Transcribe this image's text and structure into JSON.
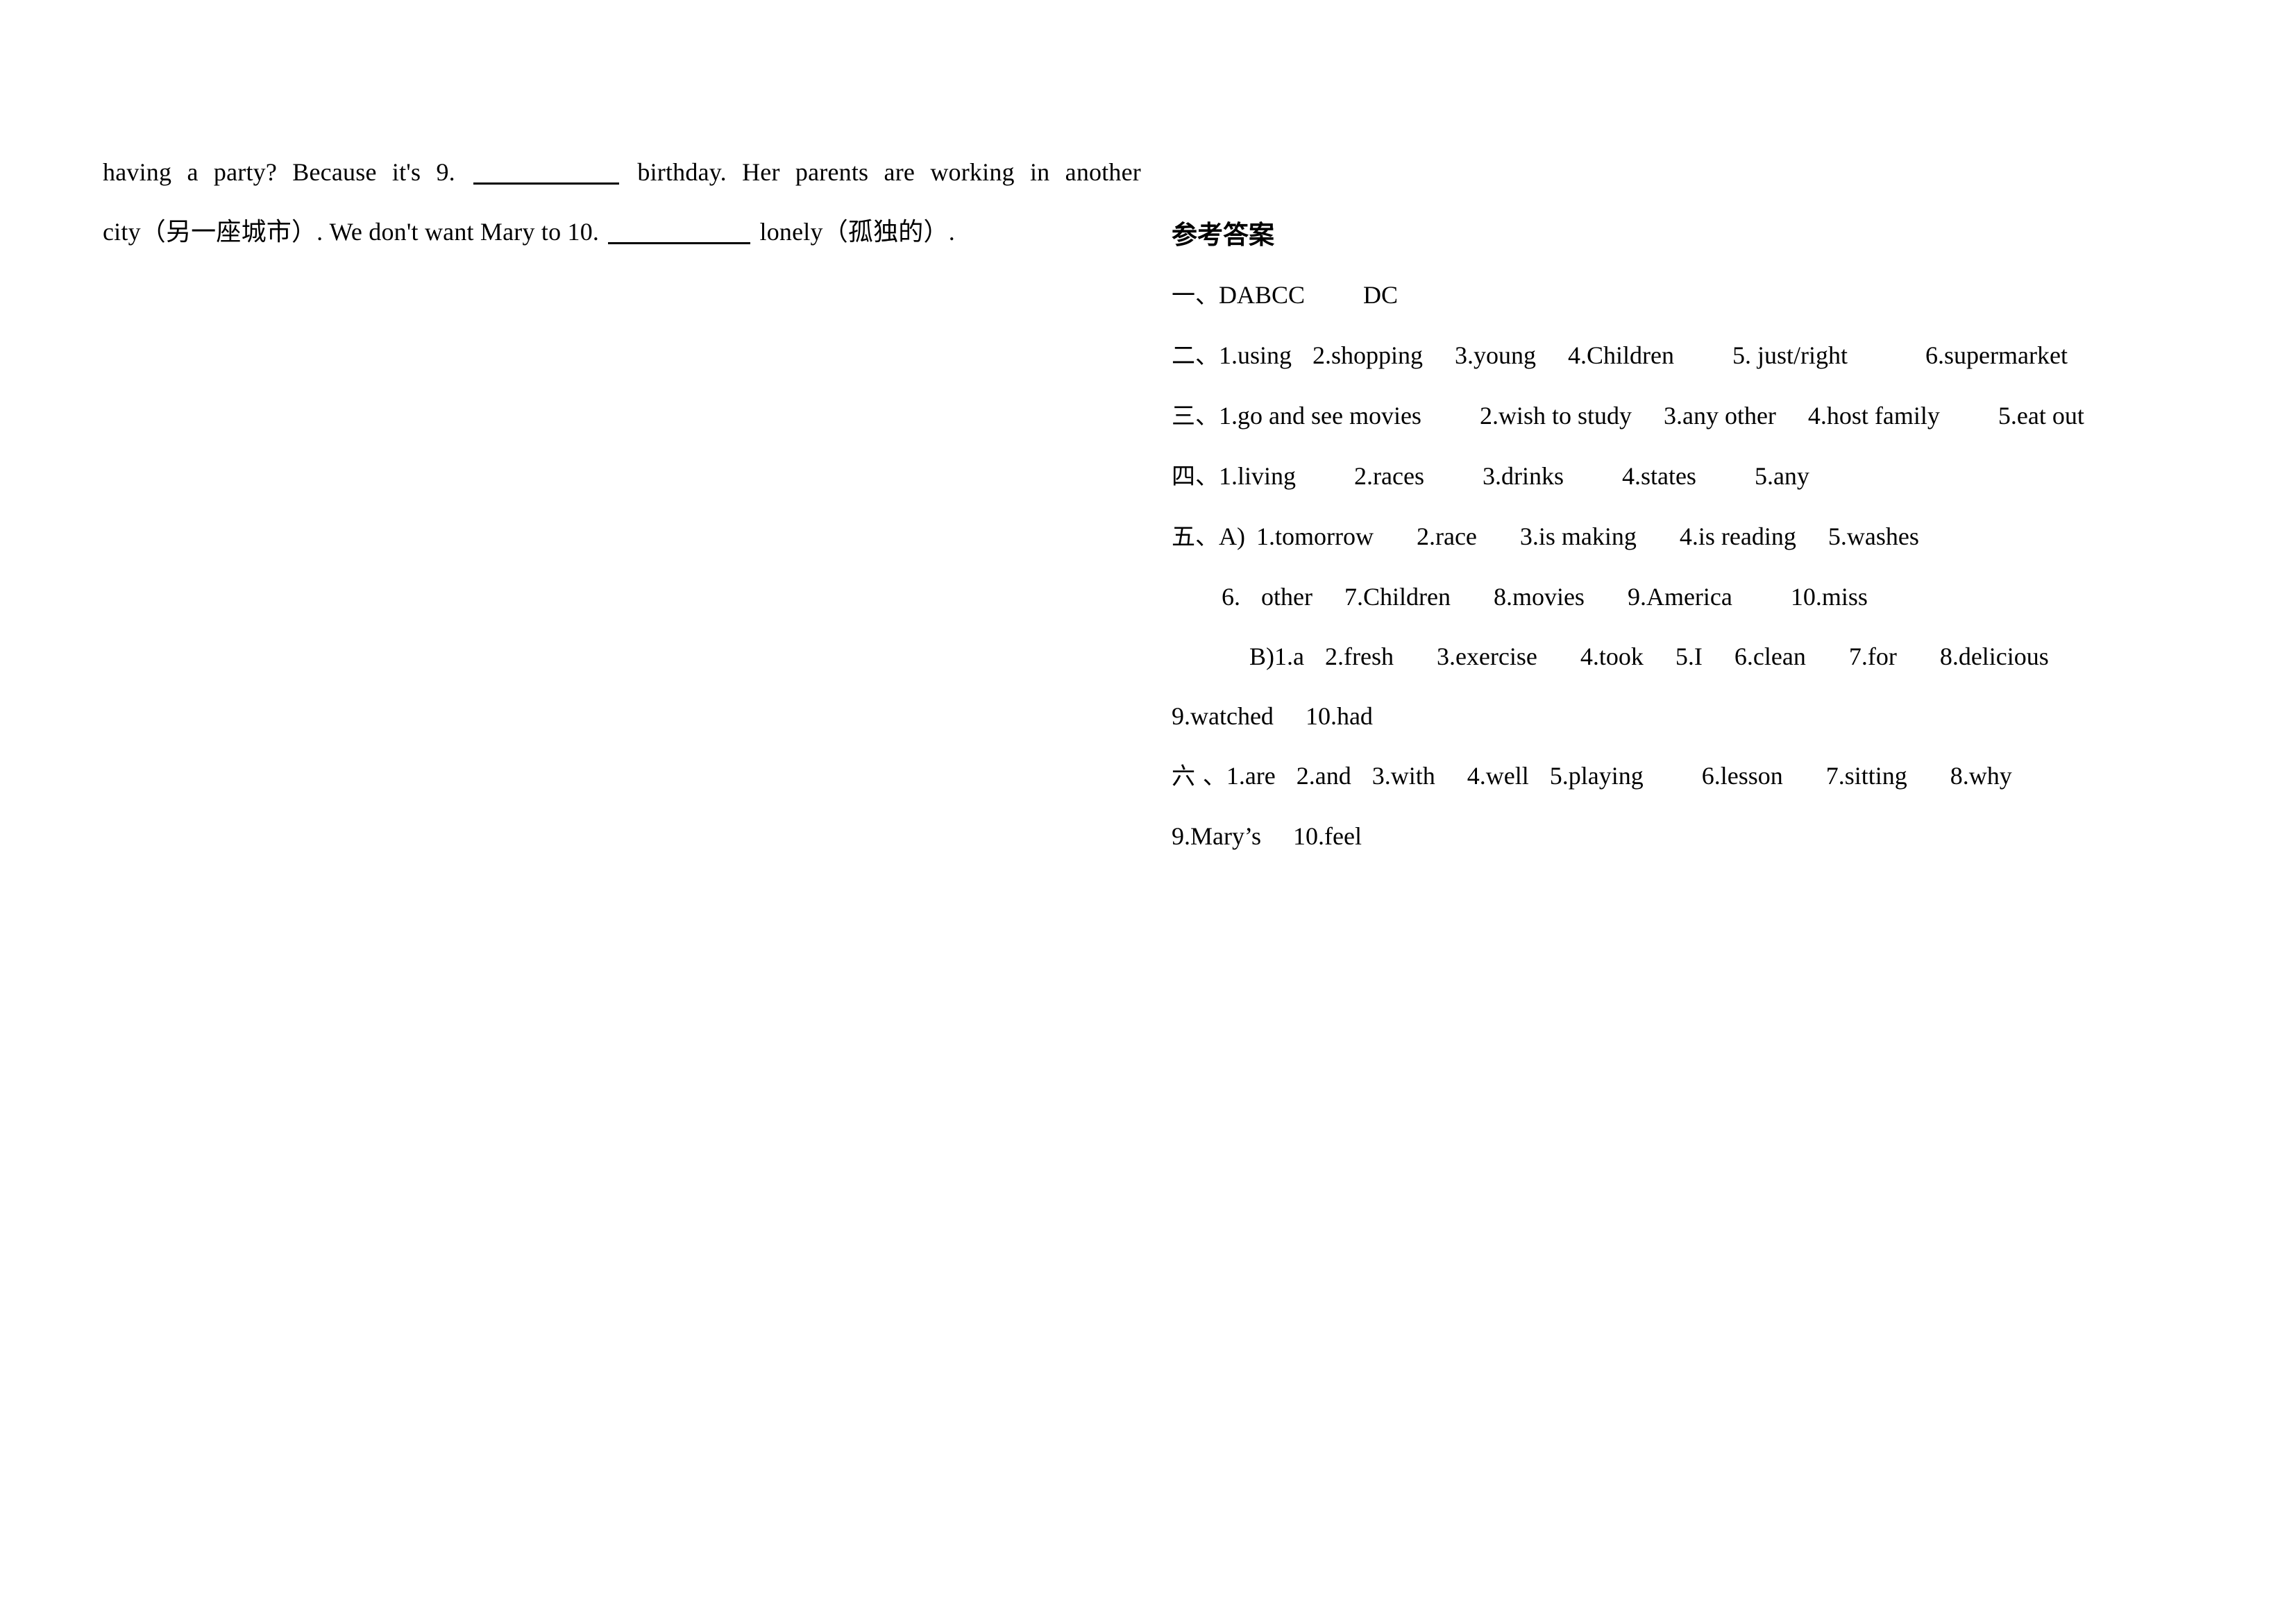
{
  "document": {
    "type": "english-exam-worksheet-with-answer-key",
    "page_background": "#ffffff",
    "text_color": "#000000"
  },
  "passage": {
    "line1": {
      "before_blank": "having a party? Because it's 9.",
      "after_blank": "birthday. Her parents are working in another"
    },
    "line2": {
      "before_blank": "city（另一座城市）. We don't want Mary to 10.",
      "after_blank": "lonely（孤独的）."
    }
  },
  "answer_key": {
    "title": "参考答案",
    "lines": [
      {
        "marker": "一、",
        "body": "DABCC",
        "body2": "DC",
        "indent": "none"
      },
      {
        "marker": "二、",
        "items": [
          "1.using",
          "2.shopping",
          "3.young",
          "4.Children",
          "5. just/right",
          "6.supermarket"
        ],
        "indent": "none"
      },
      {
        "marker": "三、",
        "items": [
          "1.go and see movies",
          "2.wish to study",
          "3.any other",
          "4.host family",
          "5.eat out"
        ],
        "indent": "none"
      },
      {
        "marker": "四、",
        "items": [
          "1.living",
          "2.races",
          "3.drinks",
          "4.states",
          "5.any"
        ],
        "indent": "none"
      },
      {
        "marker": "五、",
        "part": "A)",
        "items": [
          "1.tomorrow",
          "2.race",
          "3.is making",
          "4.is reading",
          "5.washes"
        ],
        "indent": "none"
      },
      {
        "marker": "",
        "items": [
          "6.  other",
          "7.Children",
          "8.movies",
          "9.America",
          "10.miss"
        ],
        "indent": "small"
      },
      {
        "marker": "",
        "part": "B)",
        "items": [
          "1.a",
          "2.fresh",
          "3.exercise",
          "4.took",
          "5.I",
          "6.clean",
          "7.for",
          "8.delicious"
        ],
        "indent": "medium"
      },
      {
        "marker": "",
        "items": [
          "9.watched",
          "10.had"
        ],
        "indent": "none"
      },
      {
        "marker": "六 、",
        "items": [
          "1.are",
          "2.and",
          "3.with",
          "4.well",
          "5.playing",
          "6.lesson",
          "7.sitting",
          "8.why"
        ],
        "indent": "none"
      },
      {
        "marker": "",
        "items": [
          "9.Mary’s",
          "10.feel"
        ],
        "indent": "none"
      }
    ],
    "flat": {
      "l1_marker": "一、",
      "l1_a": "DABCC",
      "l1_b": "DC",
      "l2_marker": "二、",
      "l2_1": "1.using",
      "l2_2": "2.shopping",
      "l2_3": "3.young",
      "l2_4": "4.Children",
      "l2_5": "5. just/right",
      "l2_6": "6.supermarket",
      "l3_marker": "三、",
      "l3_1": "1.go and see movies",
      "l3_2": "2.wish to study",
      "l3_3": "3.any other",
      "l3_4": "4.host family",
      "l3_5": "5.eat out",
      "l4_marker": "四、",
      "l4_1": "1.living",
      "l4_2": "2.races",
      "l4_3": "3.drinks",
      "l4_4": "4.states",
      "l4_5": "5.any",
      "l5_marker": "五、",
      "l5_part": "A)",
      "l5_1": "1.tomorrow",
      "l5_2": "2.race",
      "l5_3": "3.is making",
      "l5_4": "4.is reading",
      "l5_5": "5.washes",
      "l6_1": "6.",
      "l6_2": "other",
      "l6_3": "7.Children",
      "l6_4": "8.movies",
      "l6_5": "9.America",
      "l6_6": "10.miss",
      "l7_part": "B)1.a",
      "l7_2": "2.fresh",
      "l7_3": "3.exercise",
      "l7_4": "4.took",
      "l7_5": "5.I",
      "l7_6": "6.clean",
      "l7_7": "7.for",
      "l7_8": "8.delicious",
      "l8_1": "9.watched",
      "l8_2": "10.had",
      "l9_marker": "六 、",
      "l9_1": "1.are",
      "l9_2": "2.and",
      "l9_3": "3.with",
      "l9_4": "4.well",
      "l9_5": "5.playing",
      "l9_6": "6.lesson",
      "l9_7": "7.sitting",
      "l9_8": "8.why",
      "l10_1": "9.Mary’s",
      "l10_2": "10.feel"
    }
  }
}
